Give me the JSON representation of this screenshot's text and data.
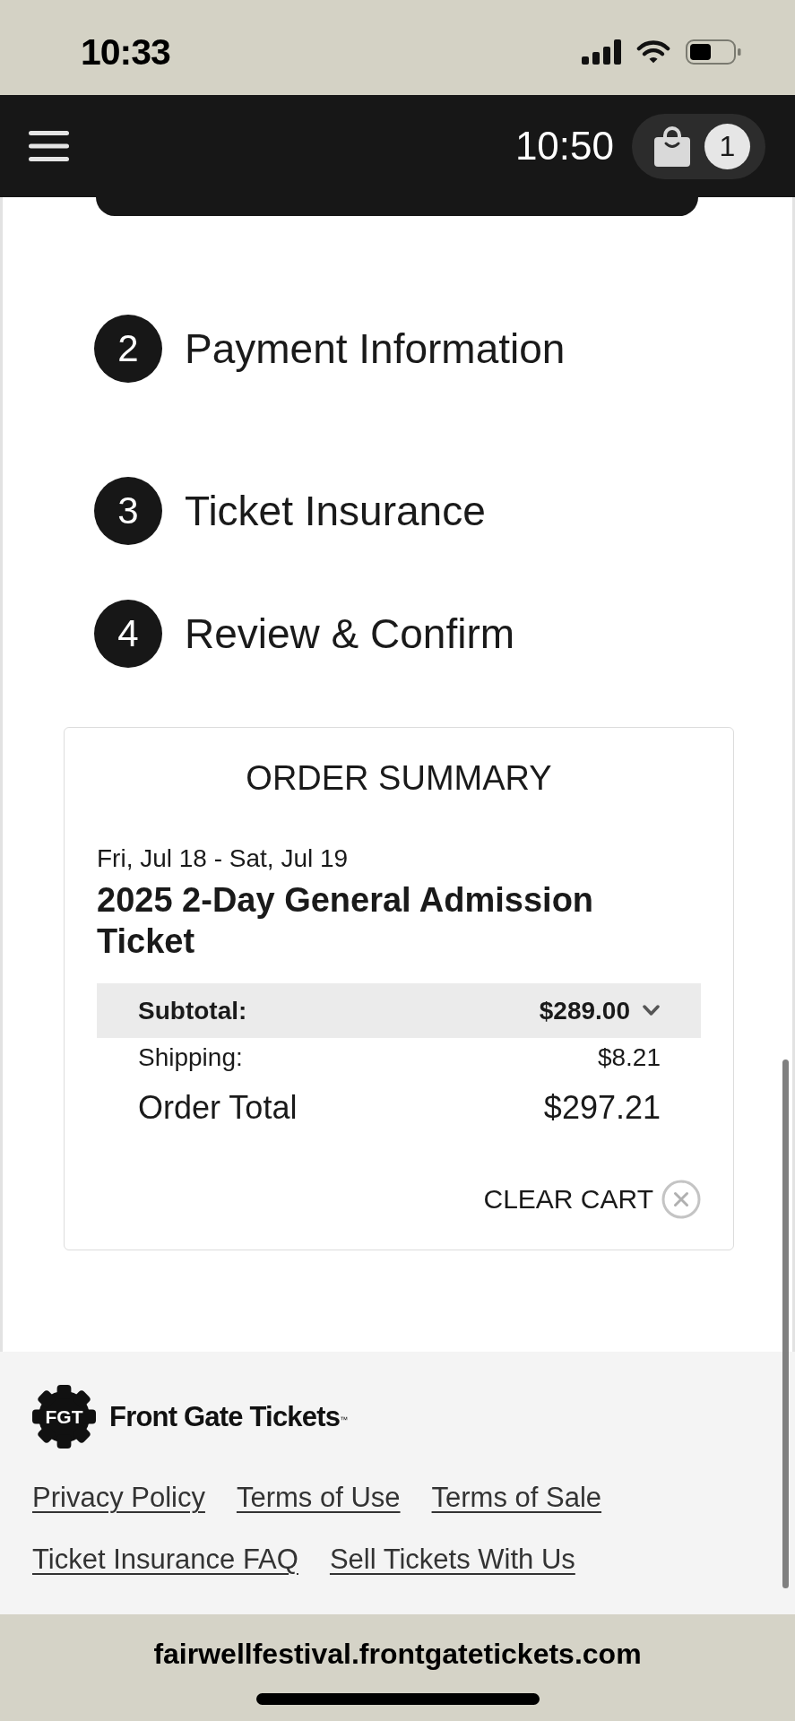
{
  "status_bar": {
    "time": "10:33"
  },
  "header": {
    "time": "10:50",
    "cart_count": "1"
  },
  "steps": [
    {
      "number": "2",
      "label": "Payment Information"
    },
    {
      "number": "3",
      "label": "Ticket Insurance"
    },
    {
      "number": "4",
      "label": "Review & Confirm"
    }
  ],
  "order_summary": {
    "title": "ORDER SUMMARY",
    "dates": "Fri, Jul 18 - Sat, Jul 19",
    "item": "2025 2-Day General Admission Ticket",
    "subtotal": {
      "label": "Subtotal:",
      "value": "$289.00"
    },
    "shipping": {
      "label": "Shipping:",
      "value": "$8.21"
    },
    "total": {
      "label": "Order Total",
      "value": "$297.21"
    },
    "clear_cart": "CLEAR CART"
  },
  "footer": {
    "logo_mark": "FGT",
    "brand": "Front Gate Tickets$^{™}$",
    "links": [
      "Privacy Policy",
      "Terms of Use",
      "Terms of Sale",
      "Ticket Insurance FAQ",
      "Sell Tickets With Us"
    ]
  },
  "browser": {
    "url": "fairwellfestival.frontgatetickets.com"
  }
}
